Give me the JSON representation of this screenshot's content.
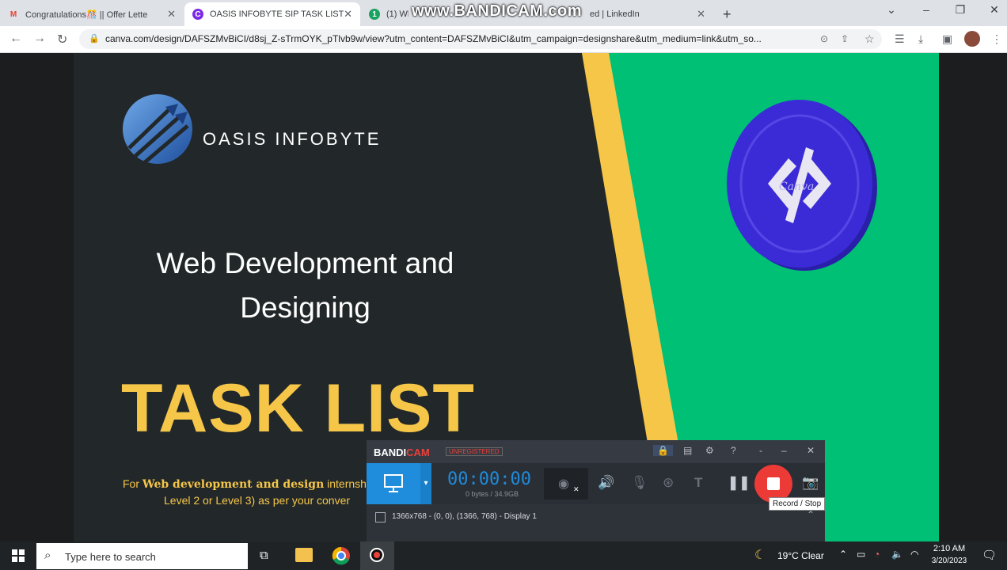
{
  "browser": {
    "tabs": [
      {
        "label": "Congratulations🎊 || Offer Lette",
        "favicon": "M",
        "favicon_color": "#ea4335"
      },
      {
        "label": "OASIS INFOBYTE SIP TASK LIST",
        "favicon": "C",
        "favicon_color": "#7d2ae8"
      },
      {
        "label": "(1) Wh",
        "favicon": "1",
        "favicon_color": "#1aa260"
      },
      {
        "label": "ed | LinkedIn",
        "favicon": "",
        "favicon_color": ""
      }
    ],
    "new_tab": "+",
    "url": "canva.com/design/DAFSZMvBiCI/d8sj_Z-sTrmOYK_pTlvb9w/view?utm_content=DAFSZMvBiCI&utm_campaign=designshare&utm_medium=link&utm_so..."
  },
  "watermark": "www.BANDICAM.com",
  "slide": {
    "brand": "OASIS INFOBYTE",
    "subtitle_line1": "Web Development and",
    "subtitle_line2": "Designing",
    "title": "TASK LIST",
    "body_prefix": "For ",
    "body_bold": "Web development and design",
    "body_rest": " internshi",
    "body_line2": "Level 2 or Level 3) as per your conver",
    "coin_watermark": "Canva",
    "colors": {
      "dark": "#22282a",
      "yellow": "#f6c649",
      "green": "#00c076",
      "coin": "#3b2bd6"
    }
  },
  "bandicam": {
    "logo_a": "BANDI",
    "logo_b": "CAM",
    "unregistered": "UNREGISTERED",
    "timer": "00:00:00",
    "size": "0 bytes / 34.9GB",
    "tooltip": "Record / Stop",
    "resolution": "1366x768 - (0, 0), (1366, 768) - Display 1"
  },
  "taskbar": {
    "search_placeholder": "Type here to search",
    "weather": "19°C  Clear",
    "time": "2:10 AM",
    "date": "3/20/2023"
  }
}
